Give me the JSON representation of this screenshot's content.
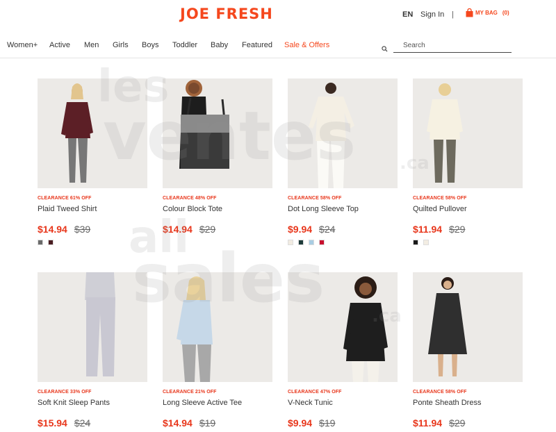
{
  "brand": {
    "logo": "JOE FRESH",
    "accent": "#f5471d"
  },
  "header": {
    "language": "EN",
    "sign_in": "Sign In",
    "separator": "|",
    "bag_label": "MY BAG",
    "bag_count": "(0)"
  },
  "nav": {
    "items": [
      "Women+",
      "Active",
      "Men",
      "Girls",
      "Boys",
      "Toddler",
      "Baby",
      "Featured",
      "Sale & Offers"
    ],
    "search_placeholder": "Search"
  },
  "watermark": {
    "line1": "les",
    "line2": "ventes",
    "line3": ".ca",
    "line4": "all",
    "line5": "sales",
    "line6": ".ca"
  },
  "products": [
    {
      "badge": "CLEARANCE 61% OFF",
      "name": "Plaid Tweed Shirt",
      "price": "$14.94",
      "original": "$39",
      "swatches": [
        "#6b6b6b",
        "#4a1e22"
      ]
    },
    {
      "badge": "CLEARANCE 48% OFF",
      "name": "Colour Block Tote",
      "price": "$14.94",
      "original": "$29",
      "swatches": []
    },
    {
      "badge": "CLEARANCE 58% OFF",
      "name": "Dot Long Sleeve Top",
      "price": "$9.94",
      "original": "$24",
      "swatches": [
        "#f1ebe2",
        "#1f3b3a",
        "#a9cde3",
        "#c8102e"
      ]
    },
    {
      "badge": "CLEARANCE 58% OFF",
      "name": "Quilted Pullover",
      "price": "$11.94",
      "original": "$29",
      "swatches": [
        "#1a1a1a",
        "#f3ede3"
      ]
    },
    {
      "badge": "CLEARANCE 33% OFF",
      "name": "Soft Knit Sleep Pants",
      "price": "$15.94",
      "original": "$24",
      "swatches": []
    },
    {
      "badge": "CLEARANCE 21% OFF",
      "name": "Long Sleeve Active Tee",
      "price": "$14.94",
      "original": "$19",
      "swatches": []
    },
    {
      "badge": "CLEARANCE 47% OFF",
      "name": "V-Neck Tunic",
      "price": "$9.94",
      "original": "$19",
      "swatches": []
    },
    {
      "badge": "CLEARANCE 58% OFF",
      "name": "Ponte Sheath Dress",
      "price": "$11.94",
      "original": "$29",
      "swatches": []
    }
  ]
}
